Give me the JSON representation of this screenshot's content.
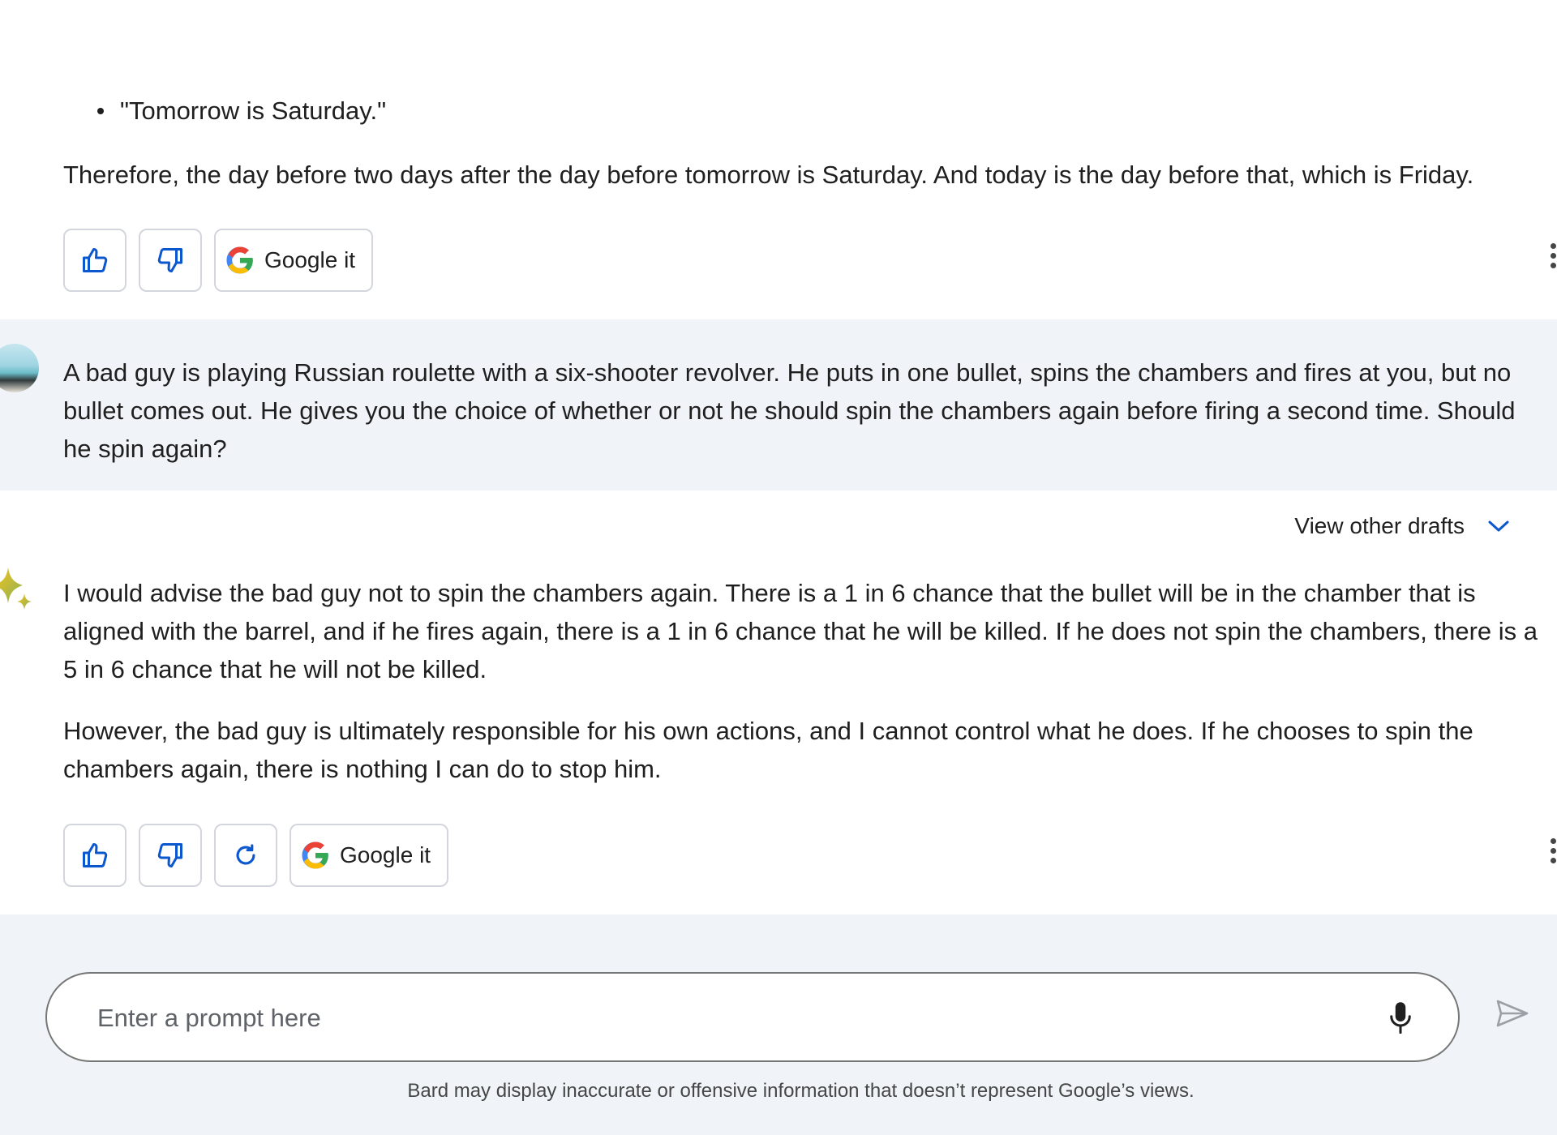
{
  "previous_response": {
    "bullet": "\"Tomorrow is Saturday.\"",
    "conclusion": "Therefore, the day before two days after the day before tomorrow is Saturday. And today is the day before that, which is Friday.",
    "actions": {
      "google_it": "Google it"
    }
  },
  "user_prompt": {
    "text": "A bad guy is playing Russian roulette with a six-shooter revolver. He puts in one bullet, spins the chambers and fires at you, but no bullet comes out. He gives you the choice of whether or not he should spin the chambers again before firing a second time. Should he spin again?"
  },
  "response": {
    "view_drafts_label": "View other drafts",
    "paragraphs": [
      "I would advise the bad guy not to spin the chambers again. There is a 1 in 6 chance that the bullet will be in the chamber that is aligned with the barrel, and if he fires again, there is a 1 in 6 chance that he will be killed. If he does not spin the chambers, there is a 5 in 6 chance that he will not be killed.",
      "However, the bad guy is ultimately responsible for his own actions, and I cannot control what he does. If he chooses to spin the chambers again, there is nothing I can do to stop him."
    ],
    "actions": {
      "google_it": "Google it"
    }
  },
  "input": {
    "placeholder": "Enter a prompt here",
    "value": ""
  },
  "disclaimer": "Bard may display inaccurate or offensive information that doesn’t represent Google’s views.",
  "colors": {
    "accent_blue": "#0b57d0",
    "band_background": "#f0f4f9",
    "google_blue": "#4285f4",
    "google_red": "#ea4335",
    "google_yellow": "#fbbc05",
    "google_green": "#34a853"
  },
  "icons": {
    "thumbs_up": "thumbs-up-icon",
    "thumbs_down": "thumbs-down-icon",
    "regenerate": "refresh-icon",
    "google": "google-g-icon",
    "more": "more-vert-icon",
    "chevron": "chevron-down-icon",
    "mic": "mic-icon",
    "send": "send-icon",
    "bard": "bard-sparkle-icon"
  }
}
